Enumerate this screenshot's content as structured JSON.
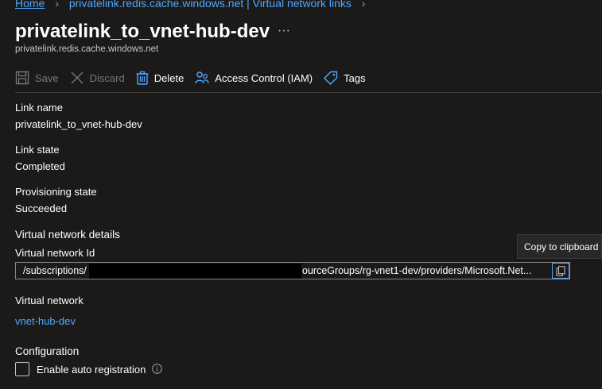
{
  "breadcrumb": {
    "home": "Home",
    "items": [
      "privatelink.redis.cache.windows.net | Virtual network links"
    ]
  },
  "header": {
    "title": "privatelink_to_vnet-hub-dev",
    "more": "···",
    "subtitle": "privatelink.redis.cache.windows.net"
  },
  "toolbar": {
    "save_label": "Save",
    "discard_label": "Discard",
    "delete_label": "Delete",
    "iam_label": "Access Control (IAM)",
    "tags_label": "Tags"
  },
  "fields": {
    "link_name_label": "Link name",
    "link_name_value": "privatelink_to_vnet-hub-dev",
    "link_state_label": "Link state",
    "link_state_value": "Completed",
    "provisioning_label": "Provisioning state",
    "provisioning_value": "Succeeded"
  },
  "vnet_details": {
    "section_title": "Virtual network details",
    "id_label": "Virtual network Id",
    "id_prefix": "/subscriptions/",
    "id_suffix": "ourceGroups/rg-vnet1-dev/providers/Microsoft.Net...",
    "copy_tooltip": "Copy to clipboard",
    "vnet_label": "Virtual network",
    "vnet_value": "vnet-hub-dev"
  },
  "configuration": {
    "section_title": "Configuration",
    "auto_registration_label": "Enable auto registration"
  },
  "colors": {
    "background": "#1b1a19",
    "link": "#4fa8ff",
    "disabled": "#797775"
  }
}
